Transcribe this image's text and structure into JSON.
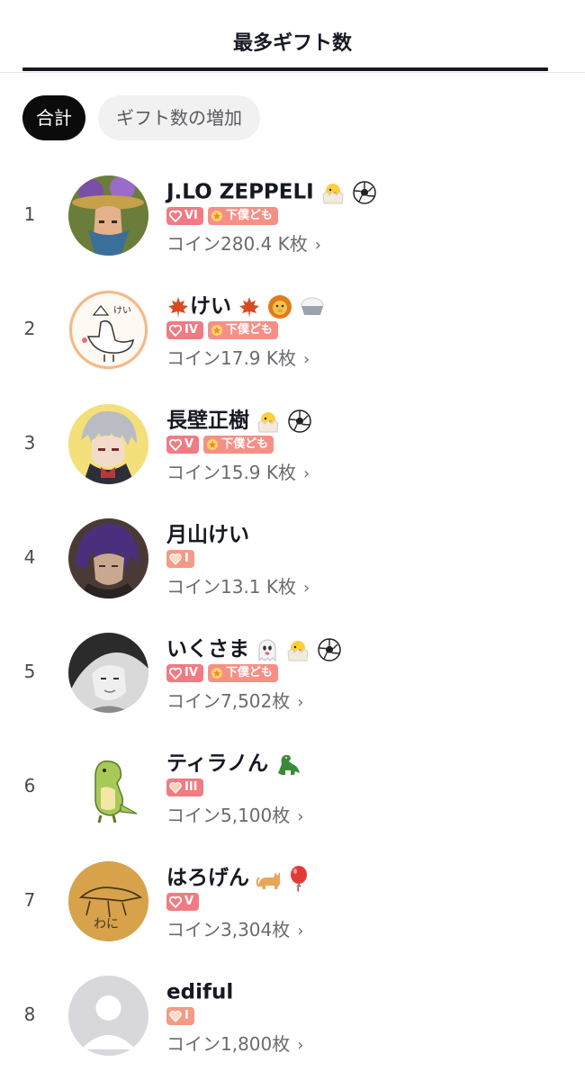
{
  "header": {
    "title": "最多ギフト数"
  },
  "filters": {
    "total_label": "合計",
    "increase_label": "ギフト数の増加"
  },
  "rows": [
    {
      "rank": "1",
      "name": "J.LO ZEPPELI",
      "emojis": [
        "chick-icon",
        "soccer-ball-icon"
      ],
      "level": "VI",
      "fan_badge": "下僕ども",
      "coins": "コイン280.4 K枚"
    },
    {
      "rank": "2",
      "name": "けい",
      "emojis": [
        "maple-leaf-icon",
        "lion-icon",
        "rice-icon"
      ],
      "level": "IV",
      "fan_badge": "下僕ども",
      "coins": "コイン17.9 K枚"
    },
    {
      "rank": "3",
      "name": "長壁正樹",
      "emojis": [
        "chick-icon",
        "soccer-ball-icon"
      ],
      "level": "V",
      "fan_badge": "下僕ども",
      "coins": "コイン15.9 K枚"
    },
    {
      "rank": "4",
      "name": "月山けい",
      "emojis": [],
      "level": "I",
      "fan_badge": "",
      "coins": "コイン13.1 K枚"
    },
    {
      "rank": "5",
      "name": "いくさま",
      "emojis": [
        "ghost-icon",
        "chick-icon",
        "soccer-ball-icon"
      ],
      "level": "IV",
      "fan_badge": "下僕ども",
      "coins": "コイン7,502枚"
    },
    {
      "rank": "6",
      "name": "ティラノん",
      "emojis": [
        "dinosaur-icon"
      ],
      "level": "III",
      "fan_badge": "",
      "coins": "コイン5,100枚"
    },
    {
      "rank": "7",
      "name": "はろげん",
      "emojis": [
        "cat-icon",
        "balloon-icon"
      ],
      "level": "V",
      "fan_badge": "",
      "coins": "コイン3,304枚"
    },
    {
      "rank": "8",
      "name": "ediful",
      "emojis": [],
      "level": "I",
      "fan_badge": "",
      "coins": "コイン1,800枚"
    }
  ],
  "colors": {
    "accent": "#161823",
    "level_badge": "#f07b82",
    "fan_badge": "#f68f86",
    "chip_active": "#0b0b0b"
  }
}
